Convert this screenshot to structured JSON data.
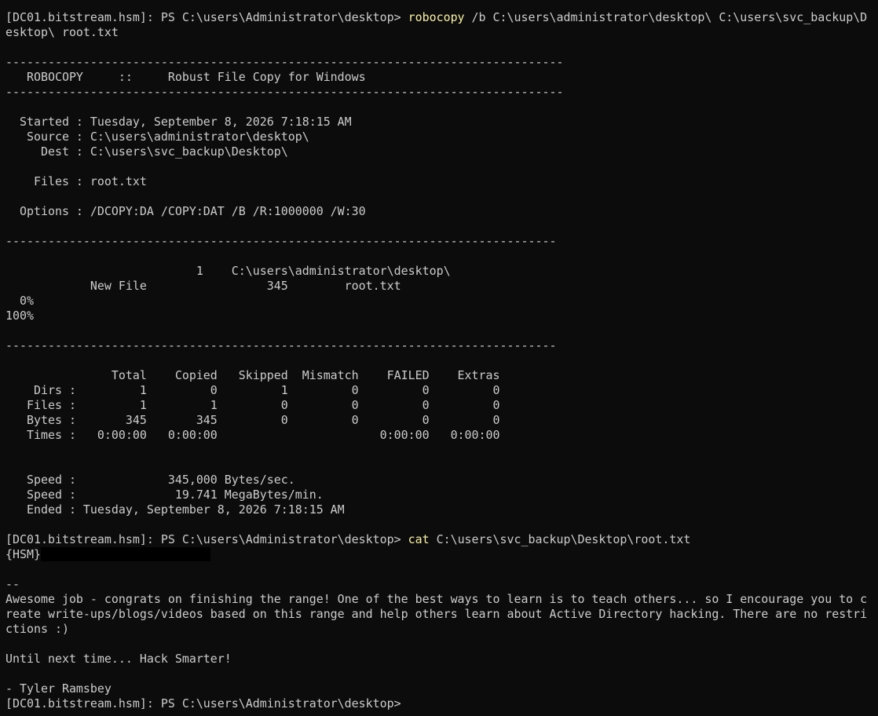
{
  "colors": {
    "background": "#0c0c0c",
    "text": "#cccccc",
    "command": "#f9f1a5",
    "redaction": "#000000"
  },
  "lines": [
    {
      "prompt": "[DC01.bitstream.hsm]: PS C:\\users\\Administrator\\desktop> ",
      "cmd": "robocopy",
      "args": " /b C:\\users\\administrator\\desktop\\ C:\\users\\svc_backup\\D"
    },
    {
      "text": "esktop\\ root.txt"
    },
    {
      "text": ""
    },
    {
      "text": "-------------------------------------------------------------------------------"
    },
    {
      "text": "   ROBOCOPY     ::     Robust File Copy for Windows"
    },
    {
      "text": "-------------------------------------------------------------------------------"
    },
    {
      "text": ""
    },
    {
      "text": "  Started : Tuesday, September 8, 2026 7:18:15 AM"
    },
    {
      "text": "   Source : C:\\users\\administrator\\desktop\\"
    },
    {
      "text": "     Dest : C:\\users\\svc_backup\\Desktop\\"
    },
    {
      "text": ""
    },
    {
      "text": "    Files : root.txt"
    },
    {
      "text": ""
    },
    {
      "text": "  Options : /DCOPY:DA /COPY:DAT /B /R:1000000 /W:30"
    },
    {
      "text": ""
    },
    {
      "text": "------------------------------------------------------------------------------"
    },
    {
      "text": ""
    },
    {
      "text": "                           1    C:\\users\\administrator\\desktop\\"
    },
    {
      "text": "            New File                 345        root.txt"
    },
    {
      "text": "  0%"
    },
    {
      "text": "100%"
    },
    {
      "text": ""
    },
    {
      "text": "------------------------------------------------------------------------------"
    },
    {
      "text": ""
    },
    {
      "text": "               Total    Copied   Skipped  Mismatch    FAILED    Extras"
    },
    {
      "text": "    Dirs :         1         0         1         0         0         0"
    },
    {
      "text": "   Files :         1         1         0         0         0         0"
    },
    {
      "text": "   Bytes :       345       345         0         0         0         0"
    },
    {
      "text": "   Times :   0:00:00   0:00:00                       0:00:00   0:00:00"
    },
    {
      "text": ""
    },
    {
      "text": ""
    },
    {
      "text": "   Speed :             345,000 Bytes/sec."
    },
    {
      "text": "   Speed :              19.741 MegaBytes/min."
    },
    {
      "text": "   Ended : Tuesday, September 8, 2026 7:18:15 AM"
    },
    {
      "text": ""
    },
    {
      "prompt": "[DC01.bitstream.hsm]: PS C:\\users\\Administrator\\desktop> ",
      "cmd": "cat",
      "args": " C:\\users\\svc_backup\\Desktop\\root.txt"
    },
    {
      "flag": "{HSM}"
    },
    {
      "text": ""
    },
    {
      "text": "--"
    },
    {
      "text": "Awesome job - congrats on finishing the range! One of the best ways to learn is to teach others... so I encourage you to c"
    },
    {
      "text": "reate write-ups/blogs/videos based on this range and help others learn about Active Directory hacking. There are no restri"
    },
    {
      "text": "ctions :)"
    },
    {
      "text": ""
    },
    {
      "text": "Until next time... Hack Smarter!"
    },
    {
      "text": ""
    },
    {
      "text": "- Tyler Ramsbey"
    },
    {
      "text": "[DC01.bitstream.hsm]: PS C:\\users\\Administrator\\desktop>"
    }
  ]
}
